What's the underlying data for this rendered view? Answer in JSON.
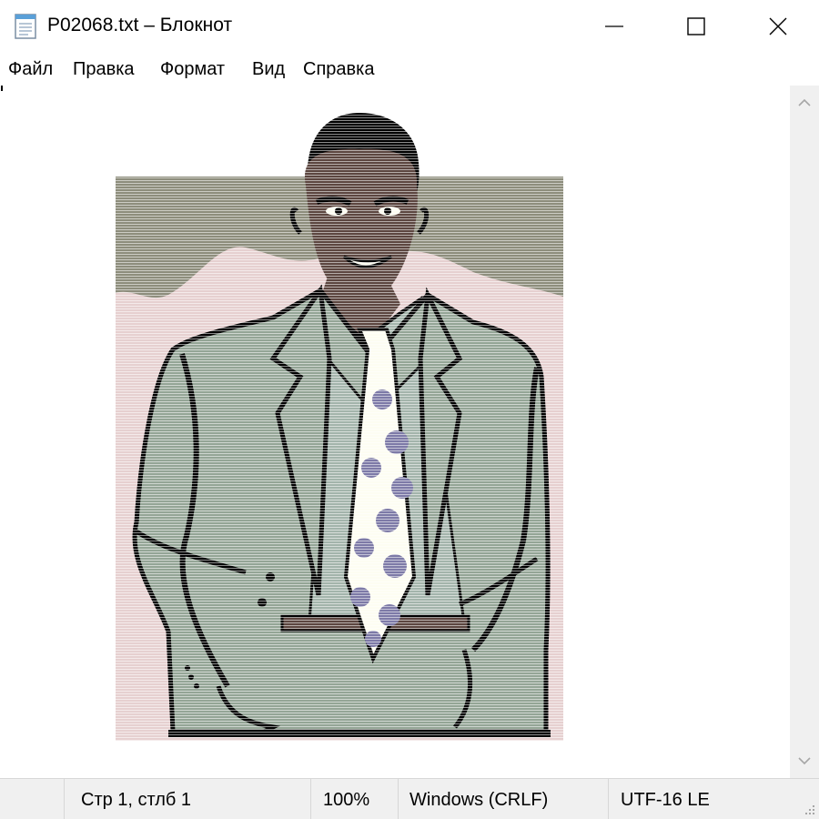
{
  "window": {
    "title": "P02068.txt – Блокнот",
    "icon": "notepad-icon",
    "controls": [
      "minimize-icon",
      "maximize-icon",
      "close-icon"
    ]
  },
  "menu": {
    "items": [
      "Файл",
      "Правка",
      "Формат",
      "Вид",
      "Справка"
    ]
  },
  "editor": {
    "content": "ASCII-art illustration: smiling man in green-gray suit with polka-dot tie",
    "colors": {
      "sky": "#8d8d7c",
      "wall": "#e6d0d0",
      "suit": "#94a596",
      "shirt": "#a3b4ab",
      "tie": "#fdfdf2",
      "dots": "#7d7aa7",
      "skin": "#5c4640",
      "outline": "#000000"
    }
  },
  "scrollbar": {
    "up": "chevron-up-icon",
    "down": "chevron-down-icon"
  },
  "status": {
    "position": "Стр 1, стлб 1",
    "zoom": "100%",
    "line_ending": "Windows (CRLF)",
    "encoding": "UTF-16 LE"
  }
}
